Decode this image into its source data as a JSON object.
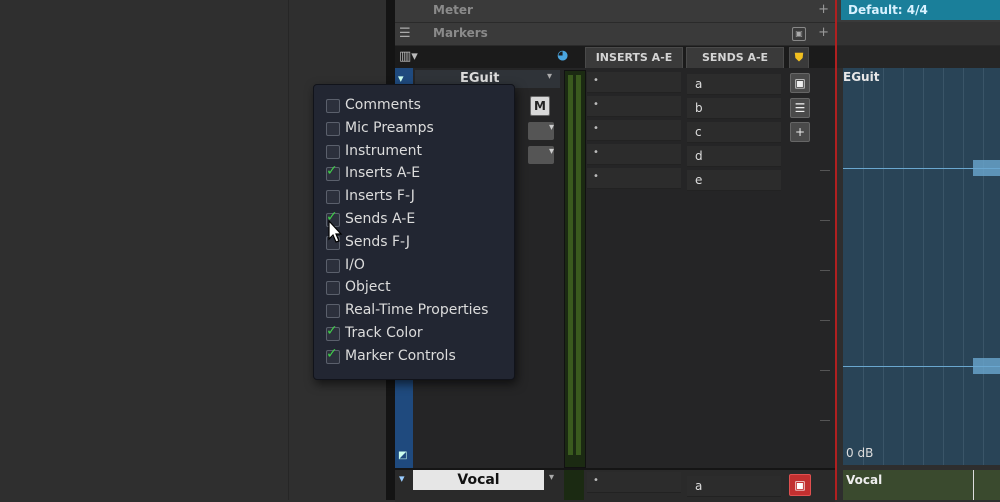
{
  "ruler": {
    "meter_label": "Meter",
    "markers_label": "Markers",
    "plus": "+",
    "time_signature": "Default: 4/4"
  },
  "header": {
    "inserts_label": "INSERTS A-E",
    "sends_label": "SENDS A-E"
  },
  "track_eguit": {
    "name": "EGuit",
    "mute_label": "M",
    "insert_slots": [
      "•",
      "•",
      "•",
      "•",
      "•"
    ],
    "send_slots": [
      "a",
      "b",
      "c",
      "d",
      "e"
    ],
    "clip_label": "EGuit",
    "gain_label": "0 dB"
  },
  "track_vocal": {
    "name": "Vocal",
    "insert_slot": "•",
    "send_slot": "a",
    "clip_label": "Vocal"
  },
  "popup_menu": {
    "items": [
      {
        "label": "Comments",
        "checked": false
      },
      {
        "label": "Mic Preamps",
        "checked": false
      },
      {
        "label": "Instrument",
        "checked": false
      },
      {
        "label": "Inserts A-E",
        "checked": true
      },
      {
        "label": "Inserts F-J",
        "checked": false
      },
      {
        "label": "Sends A-E",
        "checked": true
      },
      {
        "label": "Sends F-J",
        "checked": false
      },
      {
        "label": "I/O",
        "checked": false
      },
      {
        "label": "Object",
        "checked": false
      },
      {
        "label": "Real-Time Properties",
        "checked": false
      },
      {
        "label": "Track Color",
        "checked": true
      },
      {
        "label": "Marker Controls",
        "checked": true
      }
    ],
    "check_glyph": "✓"
  },
  "colors": {
    "accent_blue": "#1a7f9a",
    "check_green": "#3fcf4a",
    "record_red": "#c23030",
    "clip_blue": "#294457"
  }
}
